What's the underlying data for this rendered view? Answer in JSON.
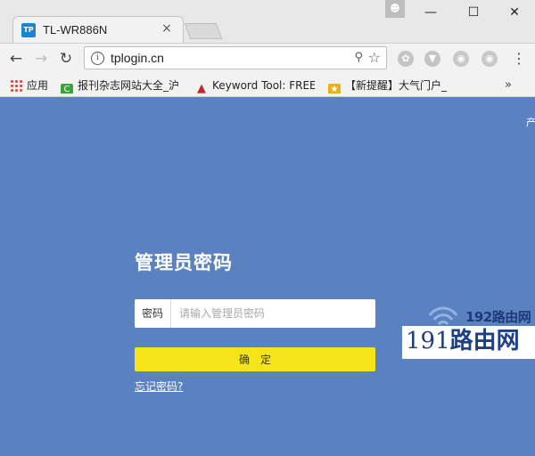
{
  "browser": {
    "tab_title": "TL-WR886N",
    "tab_favicon_text": "TP",
    "url": "tplogin.cn"
  },
  "bookmarks": [
    {
      "label": "应用",
      "icon": "apps-grid-icon"
    },
    {
      "label": "报刊杂志网站大全_沪",
      "icon": "green-c-icon"
    },
    {
      "label": "Keyword Tool: FREE",
      "icon": "flame-icon"
    },
    {
      "label": "【新提醒】大气门户_",
      "icon": "trophy-icon"
    }
  ],
  "page": {
    "corner_text": "产",
    "title": "管理员密码",
    "password_label": "密码",
    "password_placeholder": "请输入管理员密码",
    "confirm_label": "确　定",
    "forgot_label": "忘记密码?"
  },
  "watermark": {
    "top": "192路由网",
    "main_number": "191",
    "main_text": "路由网"
  },
  "colors": {
    "page_background": "#5b82c0",
    "confirm_button": "#f5e41a",
    "tab_favicon": "#1a84cf",
    "watermark_text": "#1d3f86"
  }
}
